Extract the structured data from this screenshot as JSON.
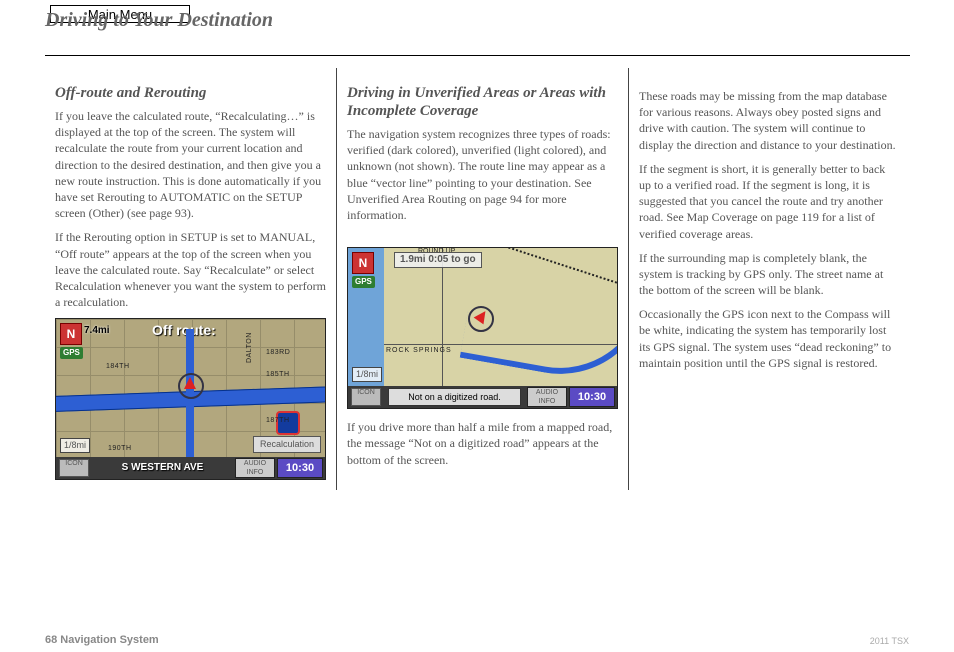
{
  "header": {
    "main_menu_label": "Main Menu",
    "section_title": "Driving to Your Destination"
  },
  "col1": {
    "h_offroute": "Off-route and Rerouting",
    "p1": "If you leave the calculated route, “Recalculating…” is displayed at the top of the screen. The system will recalculate the route from your current location and direction to the desired destination, and then give you a new route instruction. This is done automatically if you have set Rerouting to AUTOMATIC on the SETUP screen (Other) (see page 93).",
    "p2": "If the Rerouting option in SETUP is set to MANUAL, “Off route” appears at the top of the screen when you leave the calculated route. Say “Recalculate” or select Recalculation whenever you want the system to perform a recalculation."
  },
  "col2": {
    "h_unverified": "Driving in Unverified Areas or Areas with Incomplete Coverage",
    "p1": "The navigation system recognizes three types of roads: verified (dark colored), unverified (light colored), and unknown (not shown). The route line may appear as a blue “vector line” pointing to your destination. See Unverified Area Routing on page 94 for more information.",
    "p2": "If you drive more than half a mile from a mapped road, the message “Not on a digitized road” appears at the bottom of the screen."
  },
  "col3": {
    "p1": "These roads may be missing from the map database for various reasons. Always obey posted signs and drive with caution. The system will continue to display the direction and distance to your destination.",
    "p2": "If the segment is short, it is generally better to back up to a verified road. If the segment is long, it is suggested that you cancel the route and try another road. See Map Coverage on page 119 for a list of verified coverage areas.",
    "p3": "If the surrounding map is completely blank, the system is tracking by GPS only. The street name at the bottom of the screen will be blank.",
    "p4": "Occasionally the GPS icon next to the Compass will be white, indicating the system has temporarily lost its GPS signal. The system uses “dead reckoning” to maintain position until the GPS signal is restored."
  },
  "shot1": {
    "compass": "N",
    "gps": "GPS",
    "dist": "7.4mi",
    "title": "Off route:",
    "street_183": "183RD",
    "street_184": "184TH",
    "street_185": "185TH",
    "street_187": "187TH",
    "street_190": "190TH",
    "street_dalton": "DALTON",
    "scale": "1/8mi",
    "recalc": "Recalculation",
    "icon_label": "ICON",
    "street_name": "S WESTERN AVE",
    "audio": "AUDIO\nINFO",
    "clock": "10:30"
  },
  "shot2": {
    "compass": "N",
    "gps": "GPS",
    "roundup": "ROUND UP",
    "togo": "1.9mi 0:05 to go",
    "rocksprings": "ROCK SPRINGS",
    "scale": "1/8mi",
    "icon_label": "ICON",
    "msg": "Not on a digitized road.",
    "audio": "AUDIO\nINFO",
    "clock": "10:30"
  },
  "footer": {
    "left": "68   Navigation System",
    "right": "2011 TSX"
  }
}
